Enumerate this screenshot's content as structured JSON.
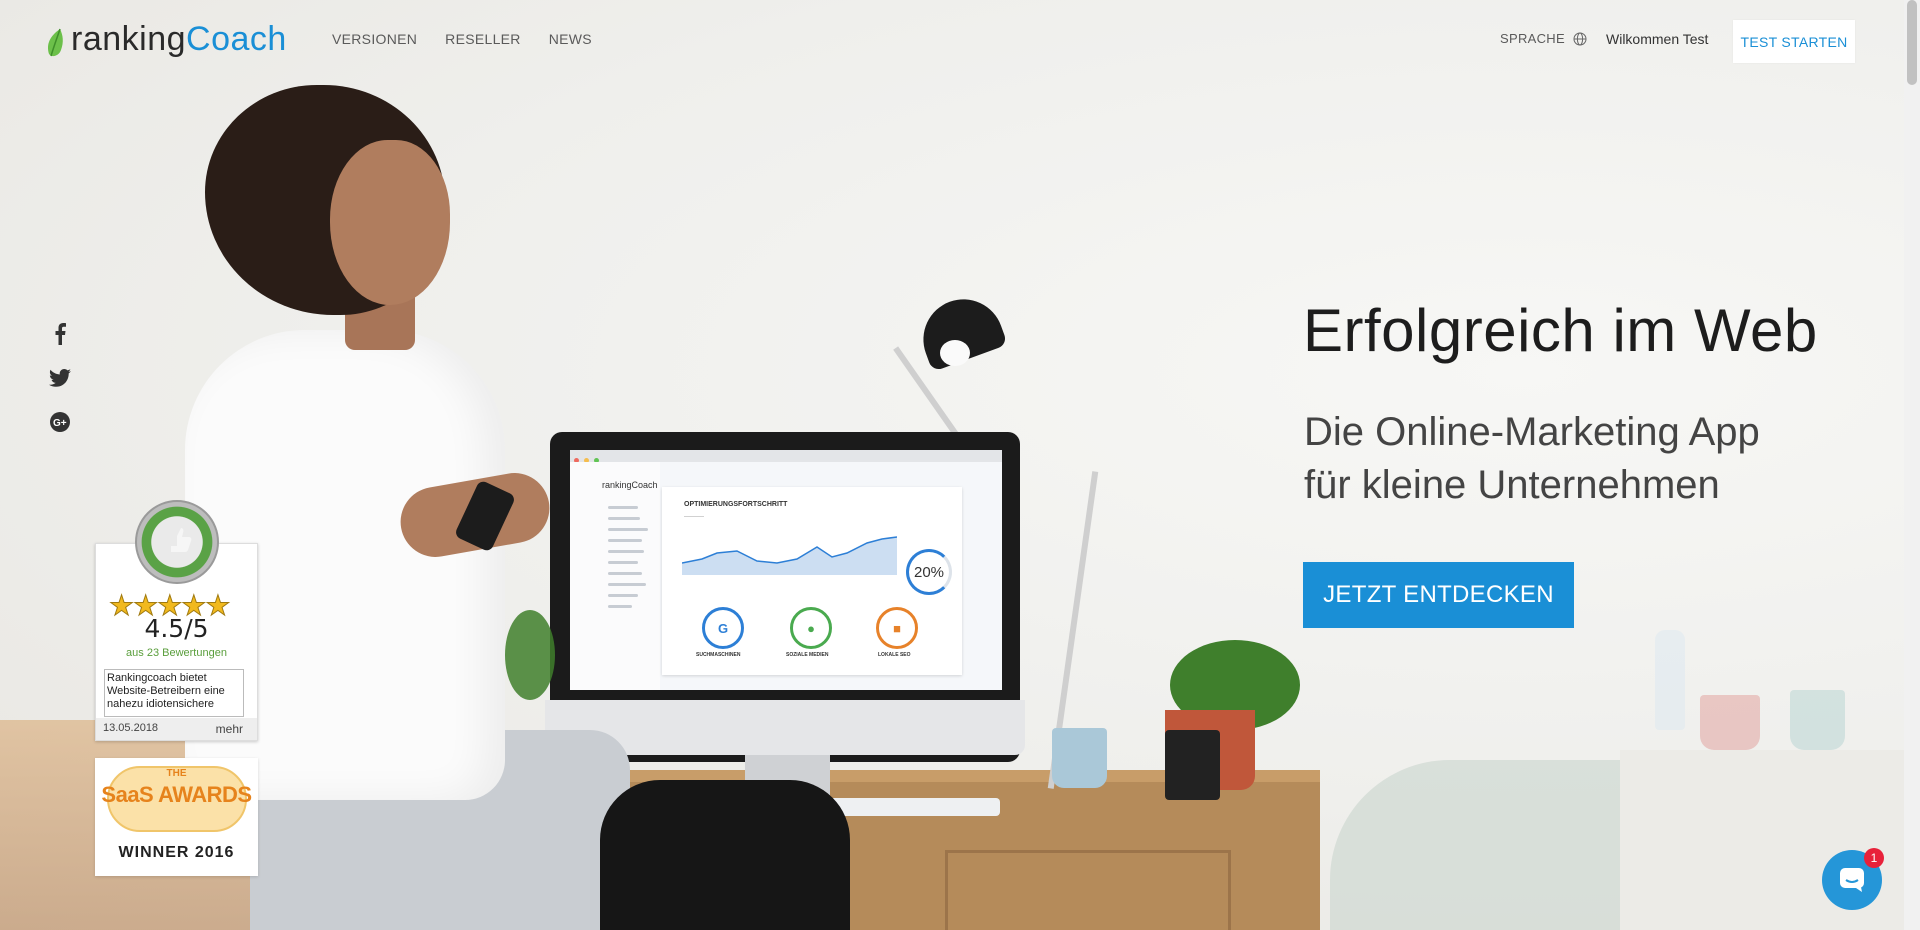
{
  "brand": {
    "ranking": "ranking",
    "coach": "Coach",
    "accent": "#1a8fd6"
  },
  "nav": {
    "items": [
      "VERSIONEN",
      "RESELLER",
      "NEWS"
    ]
  },
  "header": {
    "language_label": "SPRACHE",
    "welcome": "Wilkommen Test",
    "test_button": "TEST STARTEN"
  },
  "social": {
    "icons": [
      "facebook-icon",
      "twitter-icon",
      "google-plus-icon"
    ]
  },
  "hero": {
    "headline": "Erfolgreich im Web",
    "subline_1": "Die Online-Marketing App",
    "subline_2": "für kleine Unternehmen",
    "cta": "JETZT ENTDECKEN"
  },
  "screen": {
    "logo": "rankingCoach",
    "card_title": "OPTIMIERUNGSFORTSCHRITT",
    "percent": "20%",
    "kpis": [
      "SUCHMASCHINEN",
      "SOZIALE MEDIEN",
      "LOKALE SEO"
    ]
  },
  "ekomi": {
    "stars": "★★★★★",
    "rating_fraction": 0.9,
    "score": "4.5/5",
    "count": "aus 23 Bewertungen",
    "review": "Rankingcoach bietet Website-Betreibern eine nahezu idiotensichere",
    "date": "13.05.2018",
    "more": "mehr"
  },
  "saas": {
    "the": "THE",
    "name": "SaaS AWARDS",
    "winner": "WINNER 2016"
  },
  "chat": {
    "badge": "1"
  }
}
